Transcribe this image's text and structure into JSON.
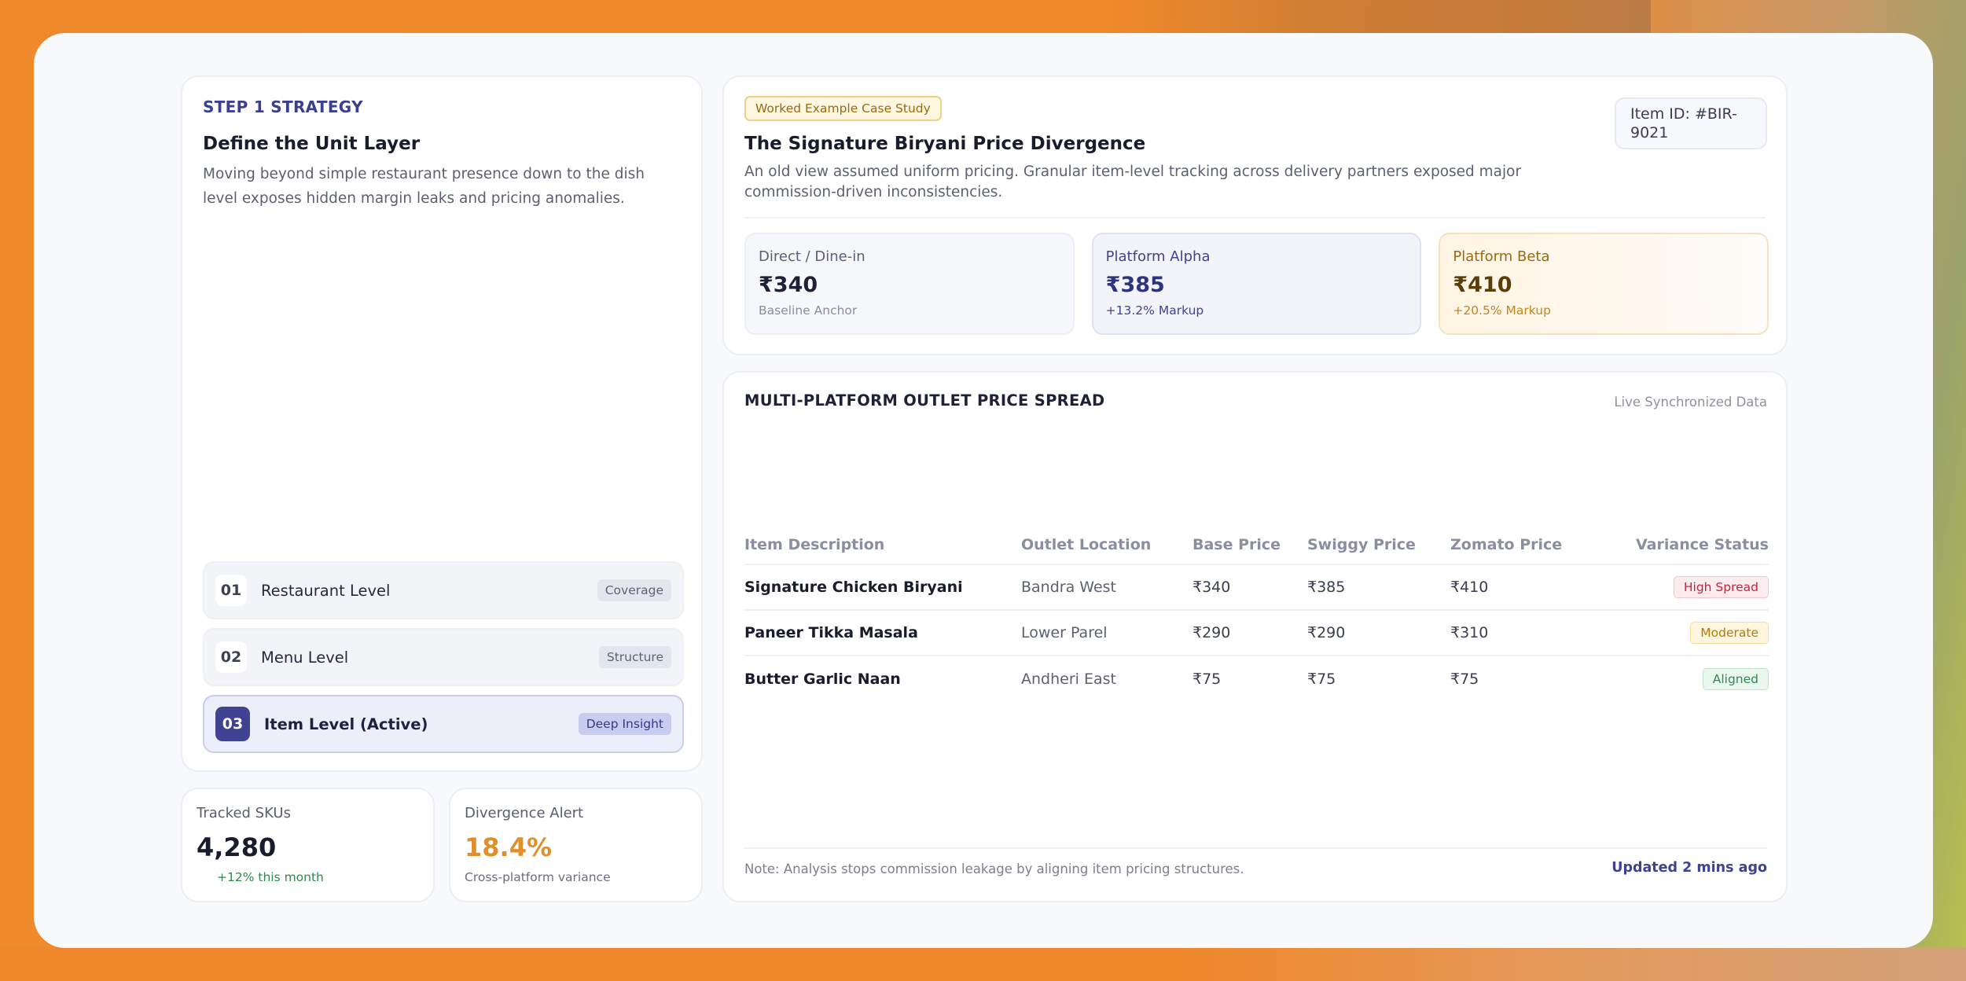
{
  "strategy": {
    "kicker": "STEP 1 STRATEGY",
    "title": "Define the Unit Layer",
    "description": "Moving beyond simple restaurant presence down to the dish level exposes hidden margin leaks and pricing anomalies.",
    "levels": [
      {
        "num": "01",
        "label": "Restaurant Level",
        "tag": "Coverage",
        "active": false
      },
      {
        "num": "02",
        "label": "Menu Level",
        "tag": "Structure",
        "active": false
      },
      {
        "num": "03",
        "label": "Item Level (Active)",
        "tag": "Deep Insight",
        "active": true
      }
    ]
  },
  "stats": {
    "tracked": {
      "label": "Tracked SKUs",
      "value": "4,280",
      "sub": "+12% this month"
    },
    "divergence": {
      "label": "Divergence Alert",
      "value": "18.4%",
      "sub": "Cross-platform variance"
    }
  },
  "case_study": {
    "badge": "Worked Example Case Study",
    "title": "The Signature Biryani Price Divergence",
    "description": "An old view assumed uniform pricing. Granular item-level tracking across delivery partners exposed major commission-driven inconsistencies.",
    "item_id": "Item ID: #BIR-9021",
    "prices": [
      {
        "label": "Direct / Dine-in",
        "value": "₹340",
        "sub": "Baseline Anchor"
      },
      {
        "label": "Platform Alpha",
        "value": "₹385",
        "sub": "+13.2% Markup"
      },
      {
        "label": "Platform Beta",
        "value": "₹410",
        "sub": "+20.5% Markup"
      }
    ]
  },
  "spread": {
    "title": "MULTI-PLATFORM OUTLET PRICE SPREAD",
    "live": "Live Synchronized Data",
    "columns": [
      "Item Description",
      "Outlet Location",
      "Base Price",
      "Swiggy Price",
      "Zomato Price",
      "Variance Status"
    ],
    "rows": [
      {
        "item": "Signature Chicken Biryani",
        "location": "Bandra West",
        "base": "₹340",
        "swiggy": "₹385",
        "zomato": "₹410",
        "status": "High Spread"
      },
      {
        "item": "Paneer Tikka Masala",
        "location": "Lower Parel",
        "base": "₹290",
        "swiggy": "₹290",
        "zomato": "₹310",
        "status": "Moderate"
      },
      {
        "item": "Butter Garlic Naan",
        "location": "Andheri East",
        "base": "₹75",
        "swiggy": "₹75",
        "zomato": "₹75",
        "status": "Aligned"
      }
    ],
    "note": "Note: Analysis stops commission leakage by aligning item pricing structures.",
    "updated": "Updated 2 mins ago"
  }
}
